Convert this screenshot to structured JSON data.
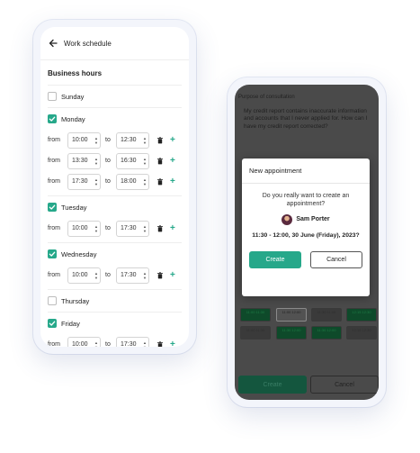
{
  "schedule": {
    "header_title": "Work schedule",
    "section_title": "Business hours",
    "from_label": "from",
    "to_label": "to",
    "days": [
      {
        "name": "Sunday",
        "checked": false,
        "slots": []
      },
      {
        "name": "Monday",
        "checked": true,
        "slots": [
          {
            "from": "10:00",
            "to": "12:30"
          },
          {
            "from": "13:30",
            "to": "16:30"
          },
          {
            "from": "17:30",
            "to": "18:00"
          }
        ]
      },
      {
        "name": "Tuesday",
        "checked": true,
        "slots": [
          {
            "from": "10:00",
            "to": "17:30"
          }
        ]
      },
      {
        "name": "Wednesday",
        "checked": true,
        "slots": [
          {
            "from": "10:00",
            "to": "17:30"
          }
        ]
      },
      {
        "name": "Thursday",
        "checked": false,
        "slots": []
      },
      {
        "name": "Friday",
        "checked": true,
        "slots": [
          {
            "from": "10:00",
            "to": "17:30"
          }
        ]
      }
    ]
  },
  "consultation": {
    "purpose_label": "Purpose of consultation",
    "purpose_text": "My credit report contains inaccurate information and accounts that I never applied for. How can I have my credit report corrected?",
    "slots_row1": [
      "11:00 11:30",
      "11:00 12:00",
      "11:30 11:45",
      "12:15 12:30"
    ],
    "slots_row2": [
      "11:00 11:30",
      "11:30 12:00",
      "11:30 12:00",
      "12:15 12:30"
    ],
    "create_label": "Create",
    "cancel_label": "Cancel"
  },
  "modal": {
    "title": "New appointment",
    "question": "Do you really want to create an appointment?",
    "person": "Sam Porter",
    "when": "11:30 - 12:00, 30 June (Friday), 2023?",
    "create_label": "Create",
    "cancel_label": "Cancel"
  },
  "colors": {
    "accent": "#26a88a",
    "overlay": "#4a4a4a"
  }
}
